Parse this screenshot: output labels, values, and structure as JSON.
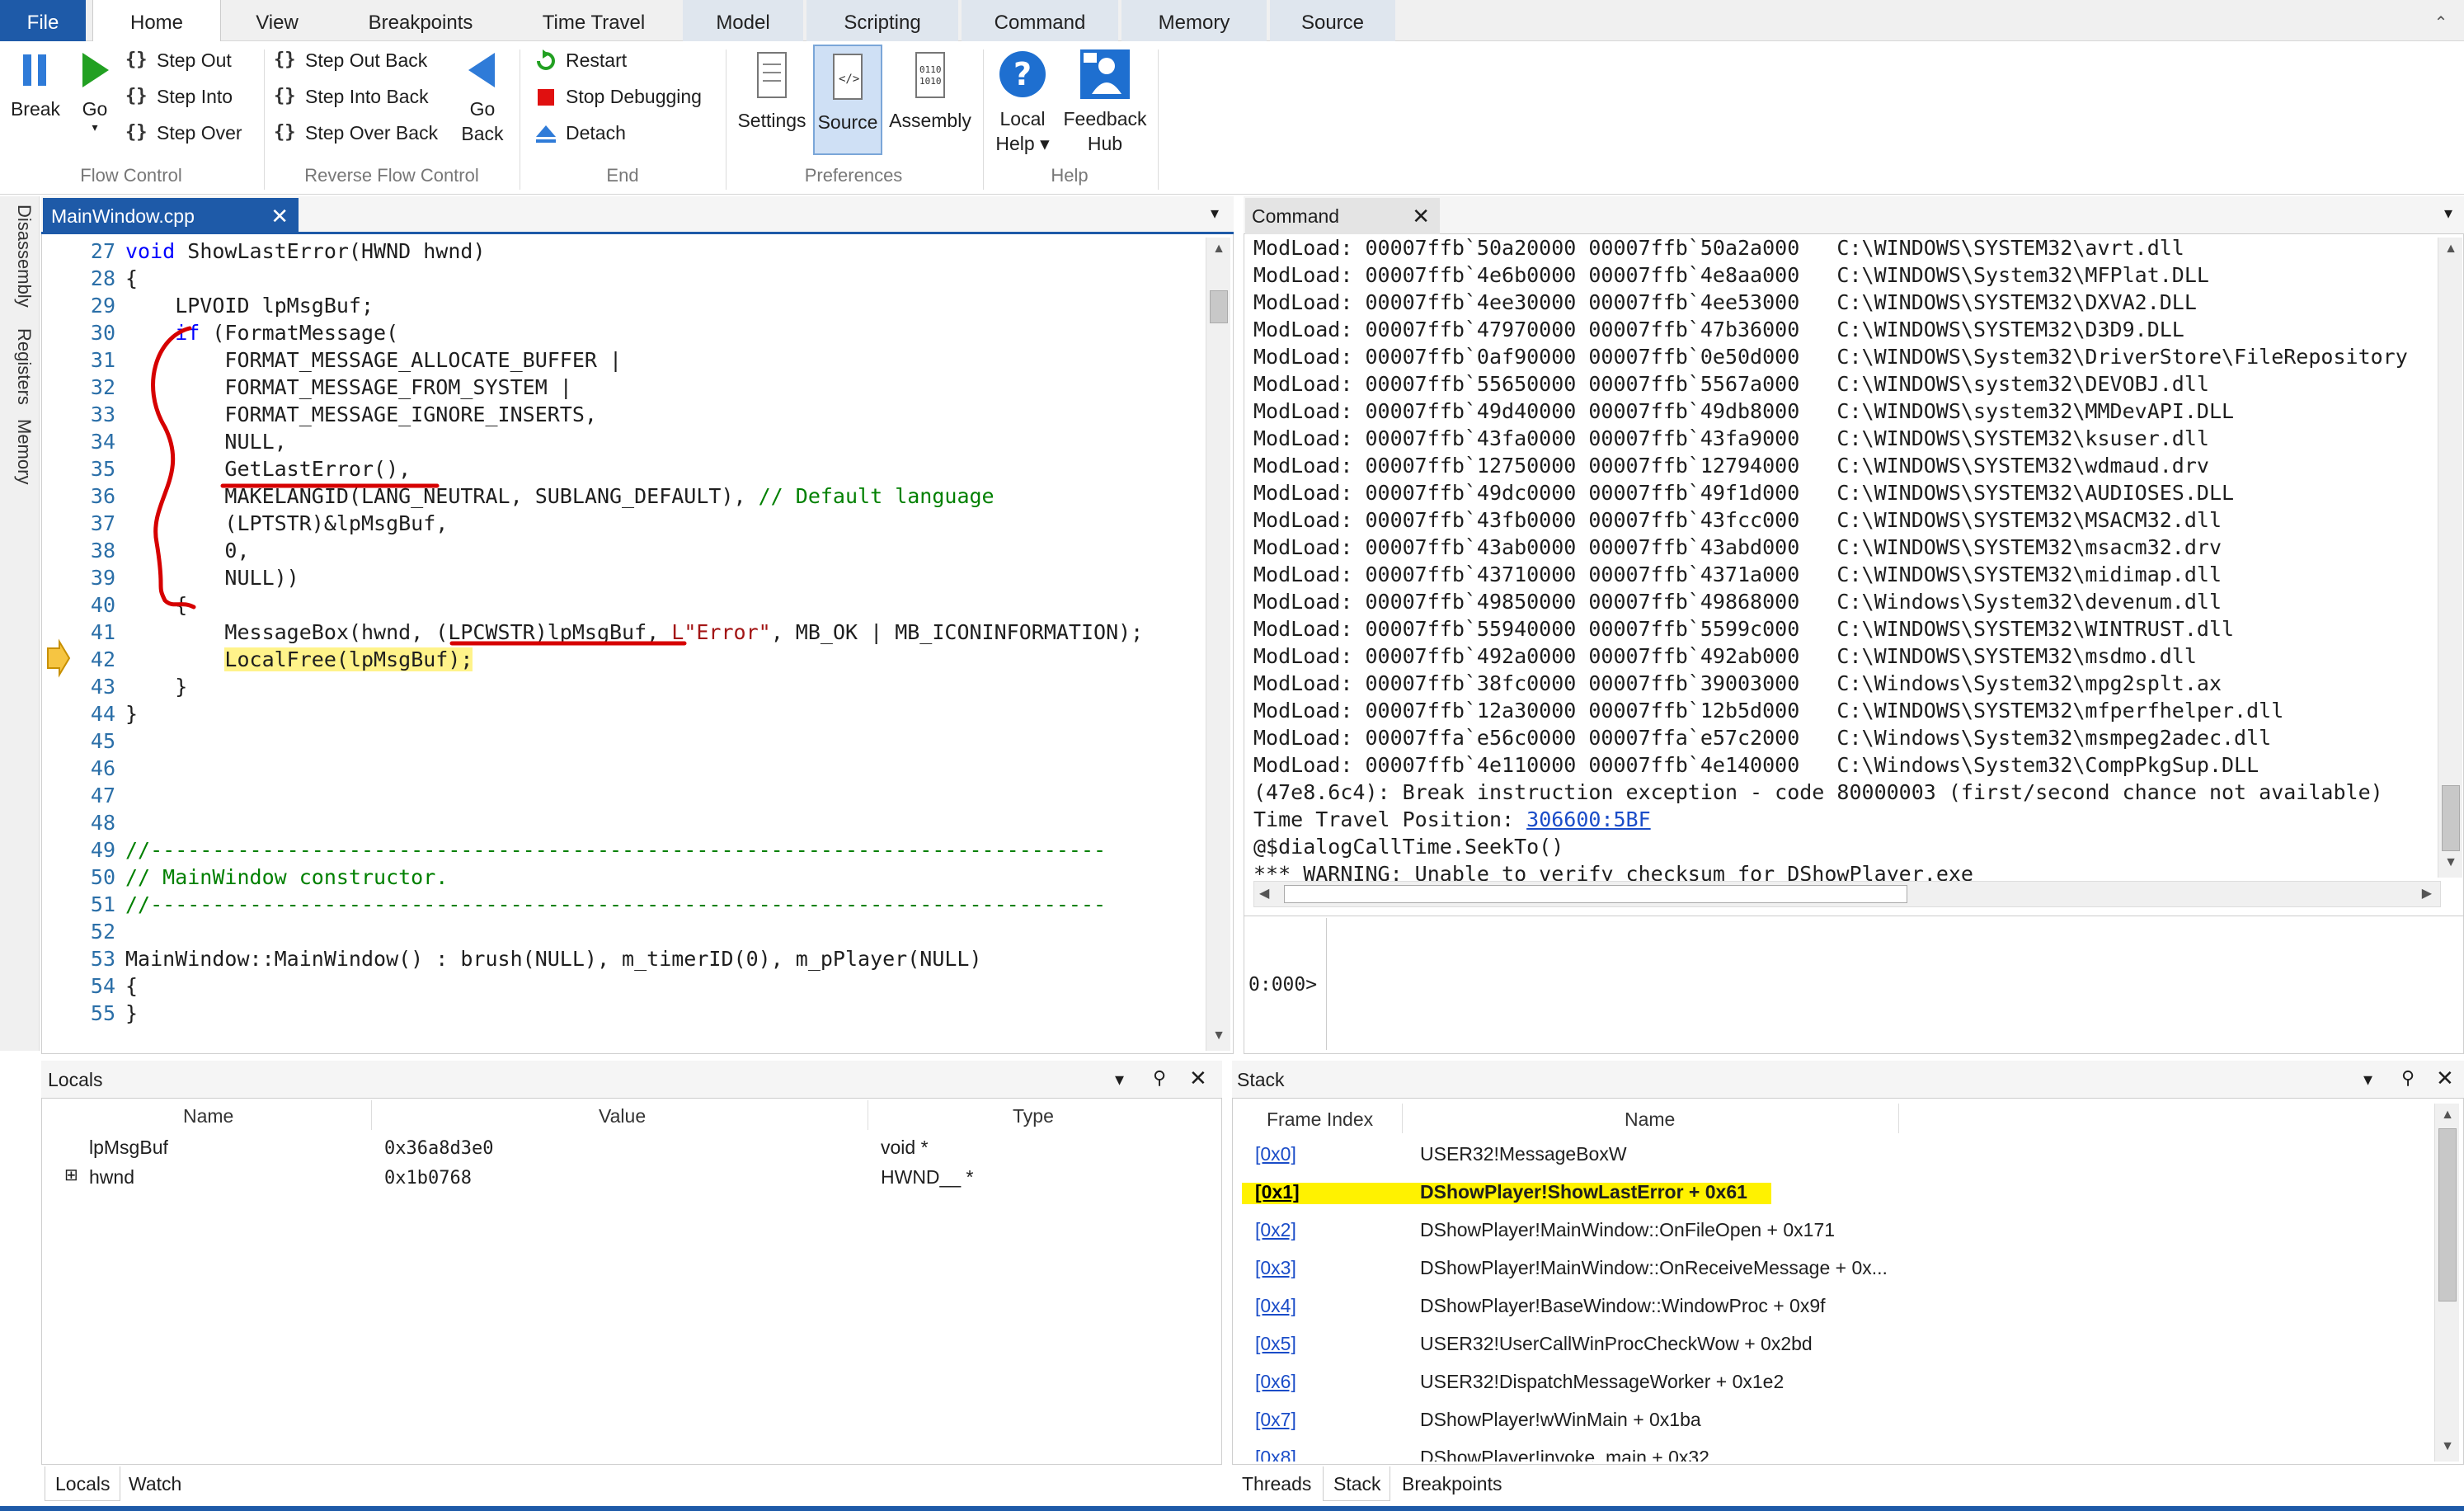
{
  "ribbon_tabs": [
    "File",
    "Home",
    "View",
    "Breakpoints",
    "Time Travel",
    "Model",
    "Scripting",
    "Command",
    "Memory",
    "Source"
  ],
  "ribbon": {
    "flow": {
      "break": "Break",
      "go": "Go",
      "step_out": "Step Out",
      "step_into": "Step Into",
      "step_over": "Step Over",
      "group": "Flow Control"
    },
    "reverse": {
      "step_out_back": "Step Out Back",
      "step_into_back": "Step Into Back",
      "step_over_back": "Step Over Back",
      "go_back_1": "Go",
      "go_back_2": "Back",
      "group": "Reverse Flow Control"
    },
    "end": {
      "restart": "Restart",
      "stop": "Stop Debugging",
      "detach": "Detach",
      "group": "End"
    },
    "prefs": {
      "settings": "Settings",
      "source": "Source",
      "assembly": "Assembly",
      "group": "Preferences"
    },
    "help": {
      "local_help_1": "Local",
      "local_help_2": "Help ▾",
      "feedback_1": "Feedback",
      "feedback_2": "Hub",
      "group": "Help"
    }
  },
  "side_tabs": [
    "Disassembly",
    "Registers",
    "Memory"
  ],
  "editor": {
    "tab": "MainWindow.cpp",
    "lines": [
      {
        "n": "27",
        "t": "void ShowLastError(HWND hwnd)"
      },
      {
        "n": "28",
        "t": "{"
      },
      {
        "n": "29",
        "t": "    LPVOID lpMsgBuf;"
      },
      {
        "n": "30",
        "t": "    if (FormatMessage("
      },
      {
        "n": "31",
        "t": "        FORMAT_MESSAGE_ALLOCATE_BUFFER |"
      },
      {
        "n": "32",
        "t": "        FORMAT_MESSAGE_FROM_SYSTEM |"
      },
      {
        "n": "33",
        "t": "        FORMAT_MESSAGE_IGNORE_INSERTS,"
      },
      {
        "n": "34",
        "t": "        NULL,"
      },
      {
        "n": "35",
        "t": "        GetLastError(),"
      },
      {
        "n": "36",
        "t": "        MAKELANGID(LANG_NEUTRAL, SUBLANG_DEFAULT), ",
        "c": "// Default language"
      },
      {
        "n": "37",
        "t": "        (LPTSTR)&lpMsgBuf,"
      },
      {
        "n": "38",
        "t": "        0,"
      },
      {
        "n": "39",
        "t": "        NULL))"
      },
      {
        "n": "40",
        "t": "    {"
      },
      {
        "n": "41",
        "t": "        MessageBox(hwnd, (LPCWSTR)lpMsgBuf, ",
        "s": "L\"Error\"",
        "r": ", MB_OK | MB_ICONINFORMATION);"
      },
      {
        "n": "42",
        "t": "        ",
        "h": "LocalFree(lpMsgBuf);"
      },
      {
        "n": "43",
        "t": "    }"
      },
      {
        "n": "44",
        "t": "}"
      },
      {
        "n": "45",
        "t": ""
      },
      {
        "n": "46",
        "t": ""
      },
      {
        "n": "47",
        "t": ""
      },
      {
        "n": "48",
        "t": ""
      },
      {
        "n": "49",
        "c": "//-----------------------------------------------------------------------------"
      },
      {
        "n": "50",
        "c": "// MainWindow constructor."
      },
      {
        "n": "51",
        "c": "//-----------------------------------------------------------------------------"
      },
      {
        "n": "52",
        "t": ""
      },
      {
        "n": "53",
        "t": "MainWindow::MainWindow() : brush(NULL), m_timerID(0), m_pPlayer(NULL)"
      },
      {
        "n": "54",
        "t": "{"
      },
      {
        "n": "55",
        "t": "}"
      }
    ]
  },
  "command": {
    "tab": "Command",
    "lines": [
      "ModLoad: 00007ffb`50a20000 00007ffb`50a2a000   C:\\WINDOWS\\SYSTEM32\\avrt.dll",
      "ModLoad: 00007ffb`4e6b0000 00007ffb`4e8aa000   C:\\WINDOWS\\System32\\MFPlat.DLL",
      "ModLoad: 00007ffb`4ee30000 00007ffb`4ee53000   C:\\WINDOWS\\SYSTEM32\\DXVA2.DLL",
      "ModLoad: 00007ffb`47970000 00007ffb`47b36000   C:\\WINDOWS\\SYSTEM32\\D3D9.DLL",
      "ModLoad: 00007ffb`0af90000 00007ffb`0e50d000   C:\\WINDOWS\\System32\\DriverStore\\FileRepository",
      "ModLoad: 00007ffb`55650000 00007ffb`5567a000   C:\\WINDOWS\\system32\\DEVOBJ.dll",
      "ModLoad: 00007ffb`49d40000 00007ffb`49db8000   C:\\WINDOWS\\system32\\MMDevAPI.DLL",
      "ModLoad: 00007ffb`43fa0000 00007ffb`43fa9000   C:\\WINDOWS\\SYSTEM32\\ksuser.dll",
      "ModLoad: 00007ffb`12750000 00007ffb`12794000   C:\\WINDOWS\\SYSTEM32\\wdmaud.drv",
      "ModLoad: 00007ffb`49dc0000 00007ffb`49f1d000   C:\\WINDOWS\\SYSTEM32\\AUDIOSES.DLL",
      "ModLoad: 00007ffb`43fb0000 00007ffb`43fcc000   C:\\WINDOWS\\SYSTEM32\\MSACM32.dll",
      "ModLoad: 00007ffb`43ab0000 00007ffb`43abd000   C:\\WINDOWS\\SYSTEM32\\msacm32.drv",
      "ModLoad: 00007ffb`43710000 00007ffb`4371a000   C:\\WINDOWS\\SYSTEM32\\midimap.dll",
      "ModLoad: 00007ffb`49850000 00007ffb`49868000   C:\\Windows\\System32\\devenum.dll",
      "ModLoad: 00007ffb`55940000 00007ffb`5599c000   C:\\WINDOWS\\SYSTEM32\\WINTRUST.dll",
      "ModLoad: 00007ffb`492a0000 00007ffb`492ab000   C:\\WINDOWS\\SYSTEM32\\msdmo.dll",
      "ModLoad: 00007ffb`38fc0000 00007ffb`39003000   C:\\Windows\\System32\\mpg2splt.ax",
      "ModLoad: 00007ffb`12a30000 00007ffb`12b5d000   C:\\WINDOWS\\SYSTEM32\\mfperfhelper.dll",
      "ModLoad: 00007ffa`e56c0000 00007ffa`e57c2000   C:\\Windows\\System32\\msmpeg2adec.dll",
      "ModLoad: 00007ffb`4e110000 00007ffb`4e140000   C:\\Windows\\System32\\CompPkgSup.DLL",
      "(47e8.6c4): Break instruction exception - code 80000003 (first/second chance not available)"
    ],
    "ttp_label": "Time Travel Position: ",
    "ttp_link": "306600:5BF",
    "line_seek": "@$dialogCallTime.SeekTo()",
    "line_warn": "*** WARNING: Unable to verify checksum for DShowPlayer.exe",
    "prompt": "0:000>"
  },
  "locals": {
    "title": "Locals",
    "headers": [
      "Name",
      "Value",
      "Type"
    ],
    "rows": [
      {
        "name": "lpMsgBuf",
        "value": "0x36a8d3e0",
        "type": "void *"
      },
      {
        "name": "hwnd",
        "value": "0x1b0768",
        "type": "HWND__ *",
        "expand": "⊞"
      }
    ],
    "tabs": [
      "Locals",
      "Watch"
    ]
  },
  "stack": {
    "title": "Stack",
    "headers": [
      "Frame Index",
      "Name"
    ],
    "rows": [
      {
        "idx": "[0x0]",
        "name": "USER32!MessageBoxW"
      },
      {
        "idx": "[0x1]",
        "name": "DShowPlayer!ShowLastError + 0x61"
      },
      {
        "idx": "[0x2]",
        "name": "DShowPlayer!MainWindow::OnFileOpen + 0x171"
      },
      {
        "idx": "[0x3]",
        "name": "DShowPlayer!MainWindow::OnReceiveMessage + 0x..."
      },
      {
        "idx": "[0x4]",
        "name": "DShowPlayer!BaseWindow::WindowProc + 0x9f"
      },
      {
        "idx": "[0x5]",
        "name": "USER32!UserCallWinProcCheckWow + 0x2bd"
      },
      {
        "idx": "[0x6]",
        "name": "USER32!DispatchMessageWorker + 0x1e2"
      },
      {
        "idx": "[0x7]",
        "name": "DShowPlayer!wWinMain + 0x1ba"
      },
      {
        "idx": "[0x8]",
        "name": "DShowPlayer!invoke_main + 0x32"
      }
    ],
    "tabs": [
      "Threads",
      "Stack",
      "Breakpoints"
    ]
  },
  "colors": {
    "accent": "#1e5aa8",
    "highlight": "#fff38a",
    "stack_highlight": "#fff200",
    "annotation": "#d60000"
  }
}
